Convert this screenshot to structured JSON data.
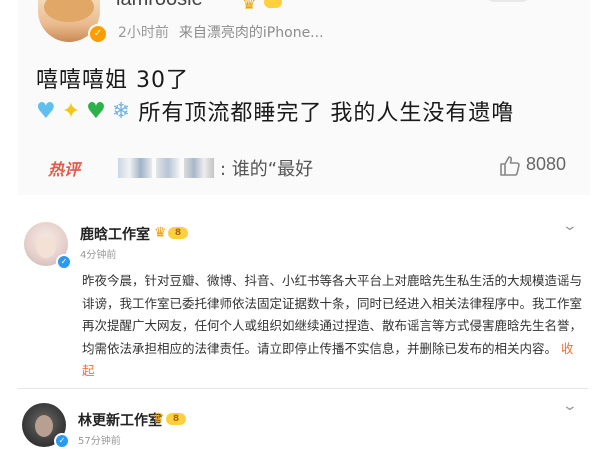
{
  "post1": {
    "username": "iamroosie",
    "time": "2小时前",
    "source": "来自漂亮肉的iPhone...",
    "text_line1": "嘻嘻嘻姐 30了",
    "text_line2": "所有顶流都睡完了 我的人生没有遗噜",
    "emojis": [
      "blue-heart",
      "sparkles",
      "green-heart",
      "snowflake"
    ],
    "hot_comment": {
      "tag": "热评",
      "text": ": 谁的“最好",
      "likes": "8080"
    }
  },
  "post2": {
    "username": "鹿晗工作室",
    "level": "8",
    "time": "4分钟前",
    "body": "昨夜今晨，针对豆瓣、微博、抖音、小红书等各大平台上对鹿晗先生私生活的大规模造谣与诽谤，我工作室已委托律师依法固定证据数十条，同时已经进入相关法律程序中。我工作室再次提醒广大网友，任何个人或组织如继续通过捏造、散布谣言等方式侵害鹿晗先生名誉，均需依法承担相应的法律责任。请立即停止传播不实信息，并删除已发布的相关内容。",
    "collapse": "收起"
  },
  "post3": {
    "username": "林更新工作室",
    "level": "8",
    "time": "57分钟前"
  },
  "colors": {
    "accent_orange": "#eb7340",
    "hot_red": "#e35a4a",
    "verify_blue": "#2a9bf0",
    "gold": "#ffcf3e"
  }
}
